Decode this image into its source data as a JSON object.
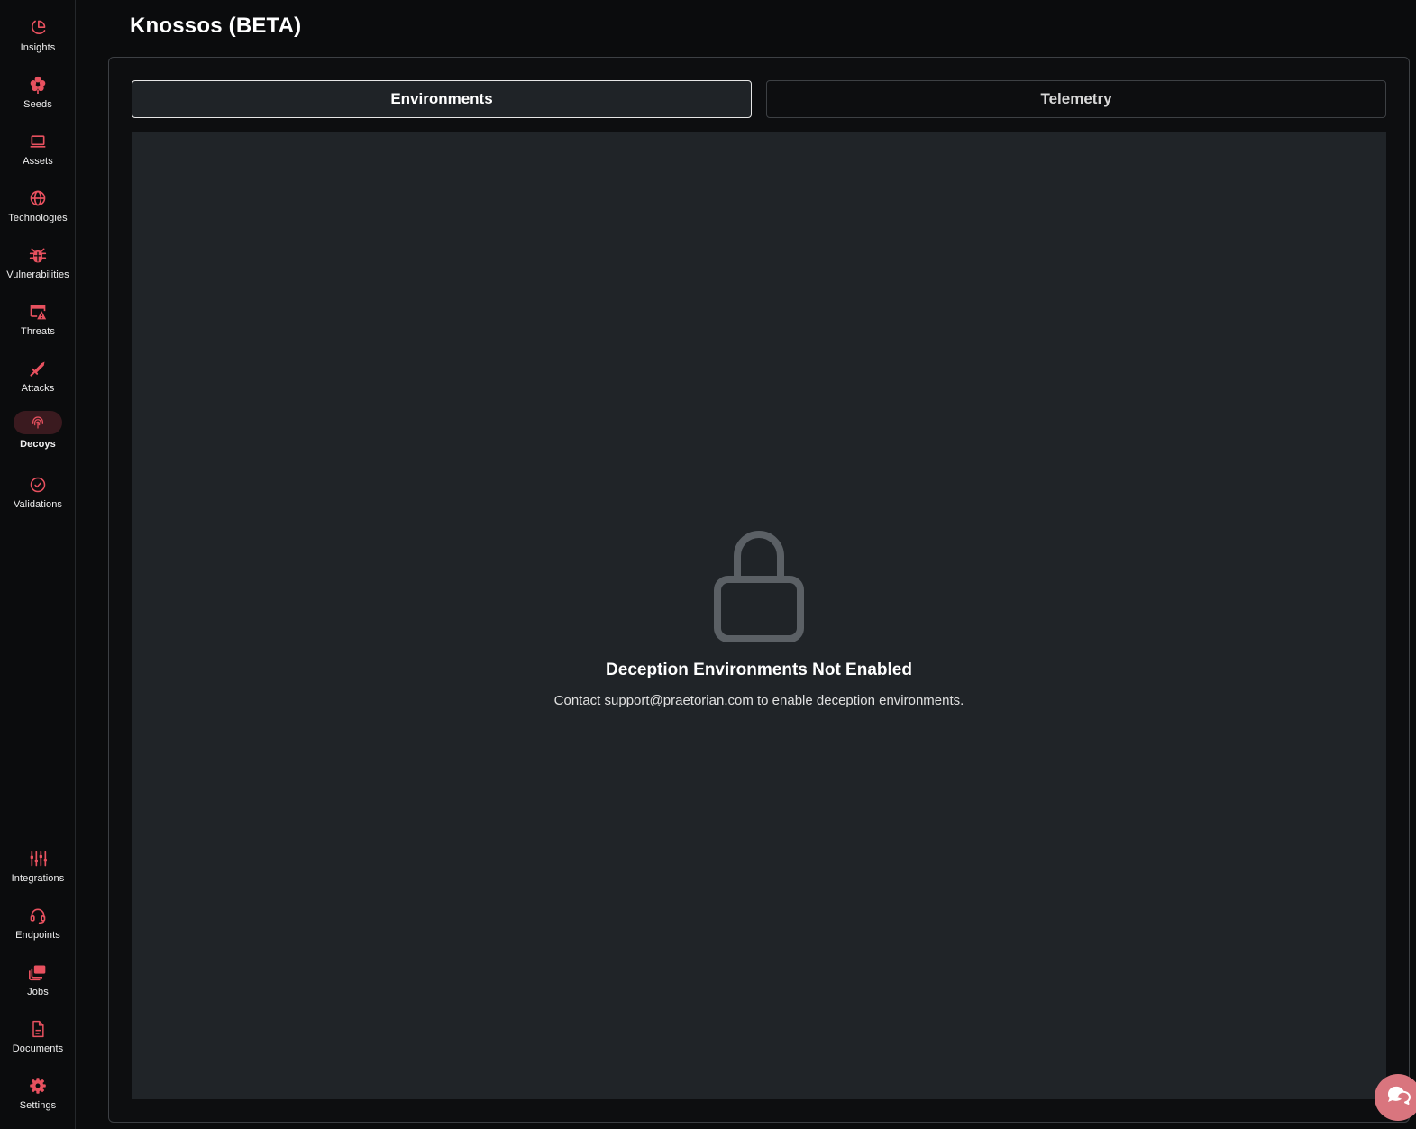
{
  "header": {
    "title": "Knossos (BETA)"
  },
  "sidebar": {
    "top_items": [
      {
        "label": "Insights",
        "icon": "pie-chart-icon"
      },
      {
        "label": "Seeds",
        "icon": "flower-icon"
      },
      {
        "label": "Assets",
        "icon": "laptop-icon"
      },
      {
        "label": "Technologies",
        "icon": "globe-icon"
      },
      {
        "label": "Vulnerabilities",
        "icon": "bug-icon"
      },
      {
        "label": "Threats",
        "icon": "window-warning-icon"
      },
      {
        "label": "Attacks",
        "icon": "sword-icon"
      },
      {
        "label": "Decoys",
        "icon": "fingerprint-icon",
        "active": true
      },
      {
        "label": "Validations",
        "icon": "check-circle-icon"
      }
    ],
    "bottom_items": [
      {
        "label": "Integrations",
        "icon": "sliders-icon"
      },
      {
        "label": "Endpoints",
        "icon": "headset-icon"
      },
      {
        "label": "Jobs",
        "icon": "stacked-cards-icon"
      },
      {
        "label": "Documents",
        "icon": "document-icon"
      },
      {
        "label": "Settings",
        "icon": "gear-icon"
      }
    ]
  },
  "tabs": [
    {
      "label": "Environments",
      "active": true
    },
    {
      "label": "Telemetry",
      "active": false
    }
  ],
  "empty_state": {
    "icon": "lock-icon",
    "title": "Deception Environments Not Enabled",
    "message": "Contact support@praetorian.com to enable deception environments."
  },
  "chat": {
    "icon": "chat-bubbles-icon"
  },
  "colors": {
    "accent": "#e8515f",
    "background": "#0b0c0d",
    "panel": "#202428",
    "chat": "#d9757e"
  }
}
